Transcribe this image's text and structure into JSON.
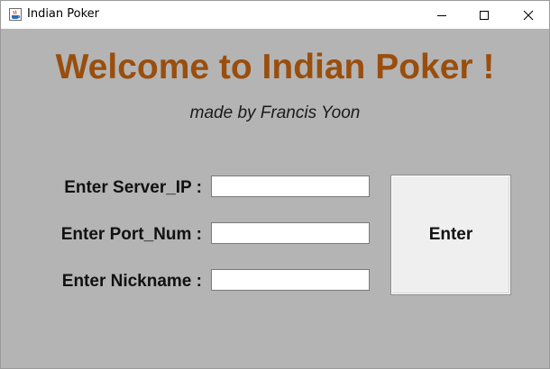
{
  "window": {
    "title": "Indian Poker",
    "controls": {
      "minimize_icon": "minimize-icon",
      "maximize_icon": "maximize-icon",
      "close_icon": "close-icon"
    }
  },
  "main": {
    "heading": "Welcome to Indian Poker !",
    "subtitle": "made by Francis Yoon",
    "form": {
      "server_ip_label": "Enter Server_IP :",
      "server_ip_value": "",
      "port_label": "Enter Port_Num :",
      "port_value": "",
      "nickname_label": "Enter Nickname :",
      "nickname_value": "",
      "enter_button_label": "Enter"
    }
  },
  "colors": {
    "background": "#b4b4b4",
    "heading": "#9a4e0d",
    "button": "#efefef"
  }
}
